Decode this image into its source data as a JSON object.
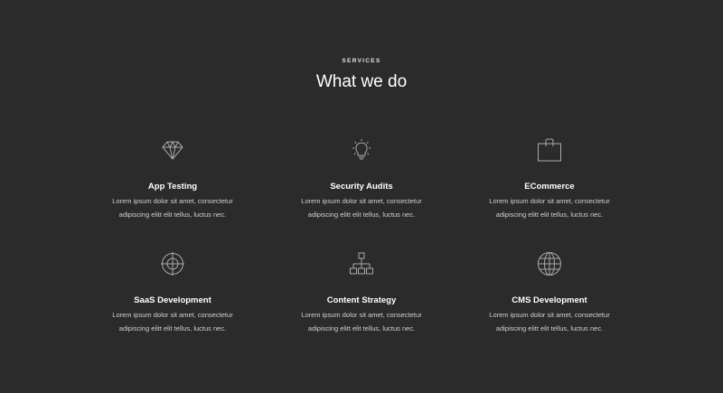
{
  "section": {
    "eyebrow": "SERVICES",
    "heading": "What we do"
  },
  "services": [
    {
      "title": "App Testing",
      "icon": "diamond-icon",
      "desc_line1": "Lorem ipsum dolor sit amet, consectetur",
      "desc_line2": "adipiscing elitt elit tellus, luctus nec."
    },
    {
      "title": "Security Audits",
      "icon": "lightbulb-icon",
      "desc_line1": "Lorem ipsum dolor sit amet, consectetur",
      "desc_line2": "adipiscing elitt elit tellus, luctus nec."
    },
    {
      "title": "ECommerce",
      "icon": "shopping-bag-icon",
      "desc_line1": "Lorem ipsum dolor sit amet, consectetur",
      "desc_line2": "adipiscing elitt elit tellus, luctus nec."
    },
    {
      "title": "SaaS Development",
      "icon": "crosshair-icon",
      "desc_line1": "Lorem ipsum dolor sit amet, consectetur",
      "desc_line2": "adipiscing elitt elit tellus, luctus nec."
    },
    {
      "title": "Content Strategy",
      "icon": "sitemap-icon",
      "desc_line1": "Lorem ipsum dolor sit amet, consectetur",
      "desc_line2": "adipiscing elitt elit tellus, luctus nec."
    },
    {
      "title": "CMS Development",
      "icon": "globe-icon",
      "desc_line1": "Lorem ipsum dolor sit amet, consectetur",
      "desc_line2": "adipiscing elitt elit tellus, luctus nec."
    }
  ],
  "colors": {
    "background": "#2b2b2b",
    "text": "#ffffff",
    "muted_text": "#d0d0d0",
    "icon_stroke": "#a8a8a8"
  }
}
